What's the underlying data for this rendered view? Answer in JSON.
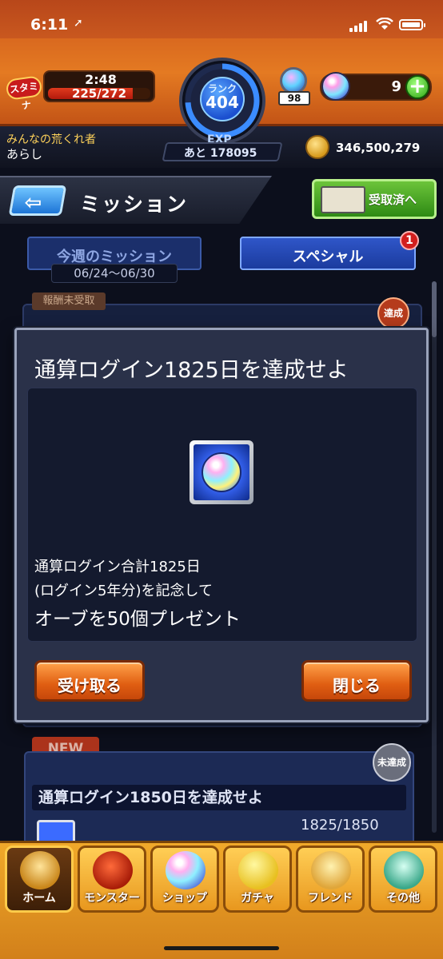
{
  "status_bar": {
    "time": "6:11",
    "location_glyph": "➚"
  },
  "header": {
    "stamina_icon_label": "スタミナ",
    "stamina_timer": "2:48",
    "stamina_count": "225/272",
    "stamina_fill": 0.827,
    "rank_label": "ランク",
    "rank_value": "404",
    "exp_label": "EXP",
    "exp_remaining": "あと 178095",
    "orb_stock_count": "98",
    "orb_count": "9",
    "orb_plus": "+",
    "player_title": "みんなの荒くれ者",
    "player_name": "あらし",
    "coins": "346,500,279"
  },
  "mission": {
    "back_arrow": "⇦",
    "title": "ミッション",
    "received_label": "受取済へ"
  },
  "tabs": {
    "weekly_label": "今週のミッション",
    "weekly_date": "06/24〜06/30",
    "special_label": "スペシャル",
    "special_badge": "1"
  },
  "list_bg": {
    "tag": "報酬未受取",
    "stamp": "達成"
  },
  "modal": {
    "title": "通算ログイン1825日を達成せよ",
    "desc_line1": "通算ログイン合計1825日",
    "desc_line2": "(ログイン5年分)を記念して",
    "desc_line3": "オーブを50個プレゼント",
    "receive_label": "受け取る",
    "close_label": "閉じる"
  },
  "next_item": {
    "new_tag": "NEW",
    "stamp": "未達成",
    "title": "通算ログイン1850日を達成せよ",
    "progress": "1825/1850"
  },
  "bottom_nav": [
    {
      "label": "ホーム",
      "icon": "home-icon",
      "active": true
    },
    {
      "label": "モンスター",
      "icon": "monster-icon",
      "active": false
    },
    {
      "label": "ショップ",
      "icon": "shop-orb-icon",
      "active": false
    },
    {
      "label": "ガチャ",
      "icon": "gacha-egg-icon",
      "active": false
    },
    {
      "label": "フレンド",
      "icon": "friend-icon",
      "active": false
    },
    {
      "label": "その他",
      "icon": "other-icon",
      "active": false
    }
  ]
}
